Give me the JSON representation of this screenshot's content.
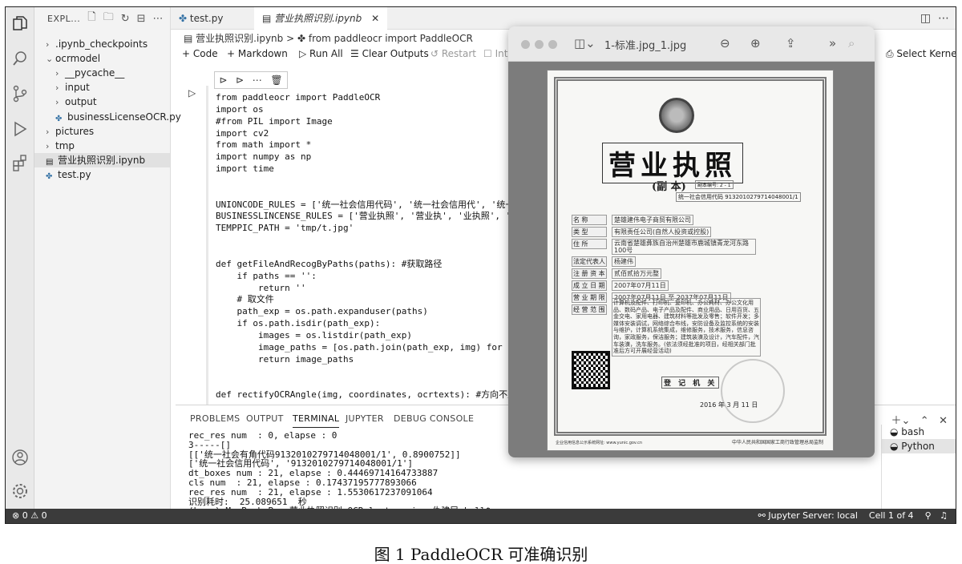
{
  "explorer": {
    "title": "EXPL...",
    "items": [
      {
        "label": ".ipynb_checkpoints",
        "kind": "folder",
        "expanded": false
      },
      {
        "label": "ocrmodel",
        "kind": "folder",
        "expanded": true
      },
      {
        "label": "__pycache__",
        "kind": "folder",
        "expanded": false
      },
      {
        "label": "input",
        "kind": "folder",
        "expanded": false
      },
      {
        "label": "output",
        "kind": "folder",
        "expanded": false
      },
      {
        "label": "businessLicenseOCR.py",
        "kind": "python"
      },
      {
        "label": "pictures",
        "kind": "folder",
        "expanded": false
      },
      {
        "label": "tmp",
        "kind": "folder",
        "expanded": false
      },
      {
        "label": "营业执照识别.ipynb",
        "kind": "notebook",
        "selected": true
      },
      {
        "label": "test.py",
        "kind": "python"
      }
    ]
  },
  "tabs": [
    {
      "label": "test.py",
      "active": false
    },
    {
      "label": "营业执照识别.ipynb",
      "active": true
    }
  ],
  "breadcrumb": {
    "file": "营业执照识别.ipynb",
    "sep": ">",
    "symbol": "from paddleocr import PaddleOCR"
  },
  "toolbar": {
    "code": "+ Code",
    "markdown": "+ Markdown",
    "run_all": "Run All",
    "clear": "Clear Outputs",
    "restart": "Restart",
    "interrupt": "Inte",
    "kernel": "Select Kernel"
  },
  "code_lines": [
    "from paddleocr import PaddleOCR",
    "import os",
    "#from PIL import Image",
    "import cv2",
    "from math import *",
    "import numpy as np",
    "import time",
    "",
    "",
    "UNIONCODE_RULES = ['统一社会信用代码', '统一社会信用代', '统一社会信用",
    "BUSINESSLINCENSE_RULES = ['营业执照', '营业执', '业执照', '执照',",
    "TEMPPIC_PATH = 'tmp/t.jpg'",
    "",
    "",
    "def getFileAndRecogByPaths(paths): #获取路径",
    "    if paths == '':",
    "        return ''",
    "    # 取文件",
    "    path_exp = os.path.expanduser(paths)",
    "    if os.path.isdir(path_exp):",
    "        images = os.listdir(path_exp)",
    "        image_paths = [os.path.join(path_exp, img) for img in i",
    "        return image_paths",
    "",
    "",
    "def rectifyOCRAngle(img, coordinates, ocrtexts): #方向不正的调整方"
  ],
  "panel": {
    "tabs": [
      "PROBLEMS",
      "OUTPUT",
      "TERMINAL",
      "JUPYTER",
      "DEBUG CONSOLE"
    ],
    "active": "TERMINAL",
    "terminal_lines": [
      "rec_res num  : 0, elapse : 0",
      "3-----[]",
      "[['统一社会有角代码91320102797140480​01/1', 0.8900752]]",
      "['统一社会信用代码', '91320102797140480​01/1']",
      "dt_boxes num : 21, elapse : 0.44469714164733887",
      "cls num  : 21, elapse : 0.17437195777893066",
      "rec_res num  : 21, elapse : 1.5530617237091064",
      "识别耗时:  25.089651  秒",
      "(base) MacBook-Pro:营业执照识别-OCR-lastversion-仇建民 ball$"
    ],
    "shells": [
      {
        "label": "bash",
        "active": false
      },
      {
        "label": "Python",
        "active": true
      }
    ]
  },
  "status": {
    "problems": "⊗ 0 ⚠ 0",
    "server": "Jupyter Server: local",
    "cell": "Cell 1 of 4"
  },
  "preview": {
    "filename": "1-标准.jpg_1.jpg",
    "doc": {
      "title": "营业执照",
      "subtitle": "(副  本)",
      "sub_note": "副本编号: 2 - 1",
      "credit_code": "统一社会信用代码 91320102797140480​01/1",
      "rows": [
        {
          "k": "名      称",
          "v": "楚雄建伟电子商贸有限公司"
        },
        {
          "k": "类      型",
          "v": "有限责任公司(自然人投资或控股)"
        },
        {
          "k": "住      所",
          "v": "云南省楚雄彝族自治州楚雄市鹿城镇青龙河东路100号"
        },
        {
          "k": "法定代表人",
          "v": "杨建伟"
        },
        {
          "k": "注 册 资 本",
          "v": "贰佰贰拾万元整"
        },
        {
          "k": "成 立 日 期",
          "v": "2007年07月11日"
        },
        {
          "k": "营 业 期 限",
          "v": "2007年07月11日  至  2037年07月11日"
        },
        {
          "k": "经 营 范 围",
          "v": ""
        }
      ],
      "scope": "计算机及配件、打印机、复印机、办公耗材、办公文化用品、数码产品、电子产品及配件、商业用品、日用百货、五金交电、家用电器、建筑材料等批发及零售；软件开发；多媒体安装调试，网络综合布线，安防设备及监控系统的安装与维护，计算机系统集成，维修服务，技术服务，信息咨询，家政服务，保洁服务；建筑装潢及设计，汽车配件，汽车装潢，洗车服务。(依法须经批准的项目，经相关部门批准后方可开展经营活动)",
      "registration": "登 记 机 关",
      "date": "2016 年 3 月 11 日",
      "footer_left": "企业信用信息公示系统网址: www.yunic.gov.cn",
      "footer_right": "中华人民共和国国家工商行政管理总局监制"
    }
  },
  "caption": "图 1  PaddleOCR 可准确识别"
}
